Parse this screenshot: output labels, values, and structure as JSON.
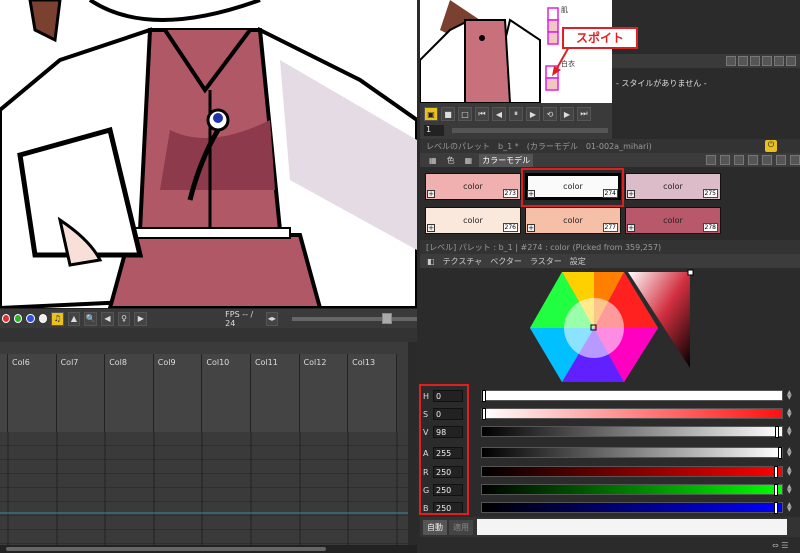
{
  "viewer": {
    "fps_label": "FPS -- / 24"
  },
  "xsheet": {
    "columns": [
      "",
      "Col6",
      "Col7",
      "Col8",
      "Col9",
      "Col10",
      "Col11",
      "Col12",
      "Col13"
    ]
  },
  "flipbook": {
    "frame_value": "1",
    "labels": {
      "hair": "肌",
      "white": "白衣"
    }
  },
  "callout": {
    "text": "スポイト"
  },
  "style_panel": {
    "no_style": "- スタイルがありません -"
  },
  "palette": {
    "title": "レベルのパレット　b_1 *　(カラーモデル　01-002a_mihari)",
    "tabs": [
      "色",
      "カラーモデル"
    ],
    "swatches": [
      {
        "label": "color",
        "num": "273",
        "color": "#f0b0b0"
      },
      {
        "label": "color",
        "num": "274",
        "color": "#fafafa"
      },
      {
        "label": "color",
        "num": "275",
        "color": "#dcbcc8"
      },
      {
        "label": "color",
        "num": "276",
        "color": "#fbe8dc"
      },
      {
        "label": "color",
        "num": "277",
        "color": "#f6c0a8"
      },
      {
        "label": "color",
        "num": "278",
        "color": "#b8586a"
      }
    ]
  },
  "style_editor": {
    "title": "[レベル] パレット : b_1 | #274 : color (Picked from 359,257)",
    "tabs": [
      "テクスチャ",
      "ベクター",
      "ラスター",
      "設定"
    ],
    "params": [
      {
        "name": "H",
        "value": "0"
      },
      {
        "name": "S",
        "value": "0"
      },
      {
        "name": "V",
        "value": "98"
      },
      {
        "name": "A",
        "value": "255"
      },
      {
        "name": "R",
        "value": "250"
      },
      {
        "name": "G",
        "value": "250"
      },
      {
        "name": "B",
        "value": "250"
      }
    ],
    "auto_label": "自動",
    "apply_label": "適用"
  }
}
